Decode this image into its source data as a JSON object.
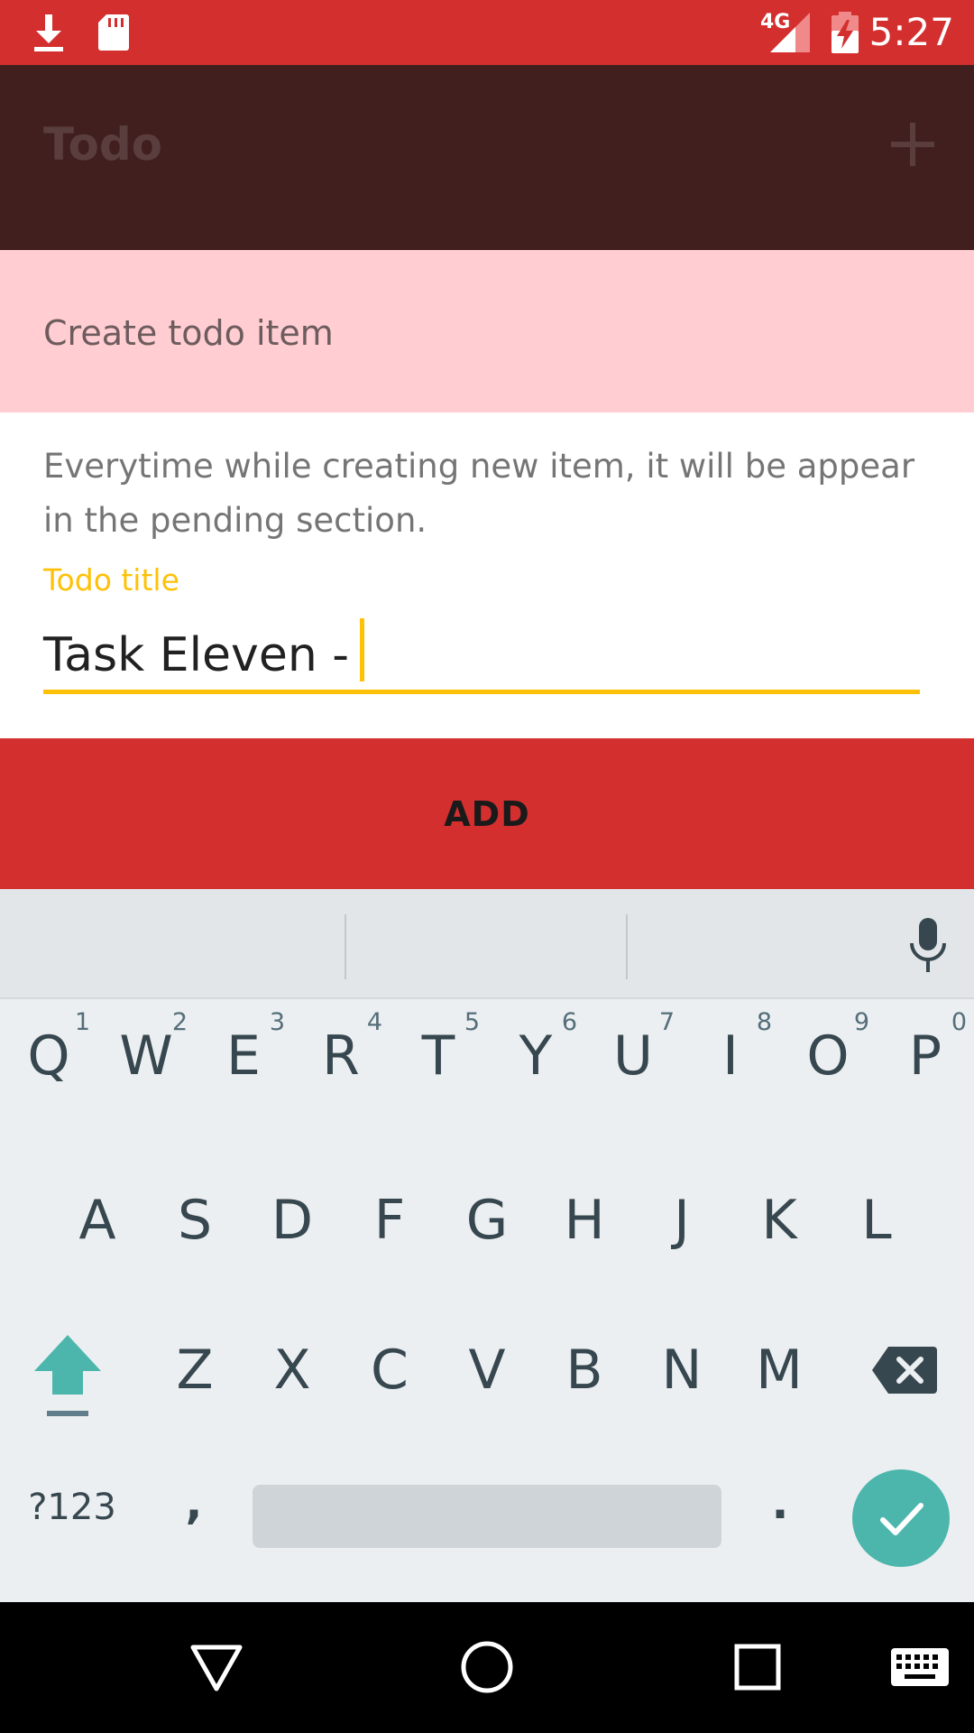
{
  "status_bar": {
    "time": "5:27",
    "network": "4G",
    "icons": [
      "download-icon",
      "sd-card-icon",
      "signal-icon",
      "battery-charging-icon"
    ]
  },
  "toolbar": {
    "title": "Todo",
    "add_icon": "plus-icon"
  },
  "dialog": {
    "title": "Create todo item",
    "message": "Everytime while creating new item, it will be appear in the pending section.",
    "field_label": "Todo title",
    "field_value": "Task Eleven -",
    "add_label": "ADD"
  },
  "keyboard": {
    "row1": [
      {
        "key": "Q",
        "hint": "1"
      },
      {
        "key": "W",
        "hint": "2"
      },
      {
        "key": "E",
        "hint": "3"
      },
      {
        "key": "R",
        "hint": "4"
      },
      {
        "key": "T",
        "hint": "5"
      },
      {
        "key": "Y",
        "hint": "6"
      },
      {
        "key": "U",
        "hint": "7"
      },
      {
        "key": "I",
        "hint": "8"
      },
      {
        "key": "O",
        "hint": "9"
      },
      {
        "key": "P",
        "hint": "0"
      }
    ],
    "row2": [
      "A",
      "S",
      "D",
      "F",
      "G",
      "H",
      "J",
      "K",
      "L"
    ],
    "row3": [
      "Z",
      "X",
      "C",
      "V",
      "B",
      "N",
      "M"
    ],
    "symbols_label": "?123",
    "comma": ",",
    "period": ".",
    "accent_color": "#4DB6AC"
  },
  "nav_bar": {
    "icons": [
      "back-icon",
      "home-icon",
      "recents-icon",
      "keyboard-icon"
    ]
  }
}
